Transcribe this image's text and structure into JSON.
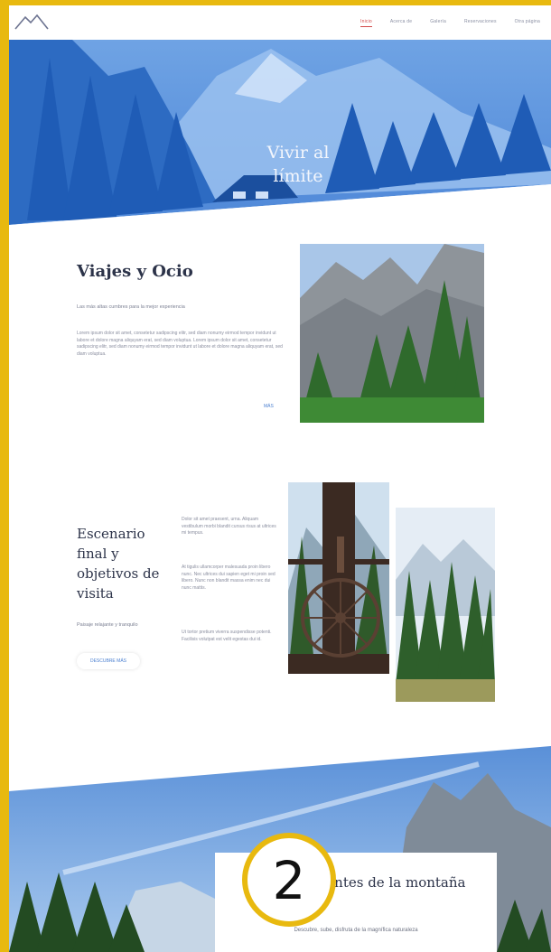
{
  "nav": {
    "logo_icon": "mountain-logo-icon",
    "items": [
      {
        "label": "Inicio",
        "active": true
      },
      {
        "label": "Acerca de",
        "active": false
      },
      {
        "label": "Galería",
        "active": false
      },
      {
        "label": "Reservaciones",
        "active": false
      },
      {
        "label": "Otra página",
        "active": false
      }
    ]
  },
  "hero": {
    "title_line1": "Vivir al",
    "title_line2": "límite"
  },
  "section1": {
    "title": "Viajes y Ocio",
    "subtitle": "Las más altas cumbres para la mejor experiencia",
    "body": "Lorem ipsum dolor sit amet, consetetur sadipscing elitr, sed diam nonumy eirmod tempor invidunt ut labore et dolore magna aliquyam erat, sed diam voluptua. Lorem ipsum dolor sit amet, consetetur sadipscing elitr, sed diam nonumy eirmod tempor invidunt ut labore et dolore magna aliquyam erat, sed diam voluptua.",
    "link": "MÁS"
  },
  "section2": {
    "title": "Escenario final y objetivos de visita",
    "subtitle": "Paisaje relajante y tranquilo",
    "button": "DESCUBRE MÁS",
    "col_p1": "Dolor sit amet praesent, urna. Aliquam vestibulum morbi blandit cursus risus at ultrices mi tempus.",
    "col_p2": "At tigulis ullamcorper malesuada proin libero nunc. Nec ultrices dui sapien eget mi proin sed libero. Nunc non blandit massa enim nec dui nunc mattis.",
    "col_p3": "Ut tortor pretium viverra suspendisse potenti. Facilisis volutpat est velit egestas dui id."
  },
  "banner": {
    "title": "Para los amantes de la montaña",
    "text": "Descubre, sube, disfruta de la magnífica naturaleza"
  },
  "badge": {
    "number": "2"
  },
  "colors": {
    "frame": "#e8b90f",
    "accent": "#d24a4a",
    "heading": "#2c3349",
    "link": "#4a7fd0",
    "sky": "#5a90d8"
  }
}
